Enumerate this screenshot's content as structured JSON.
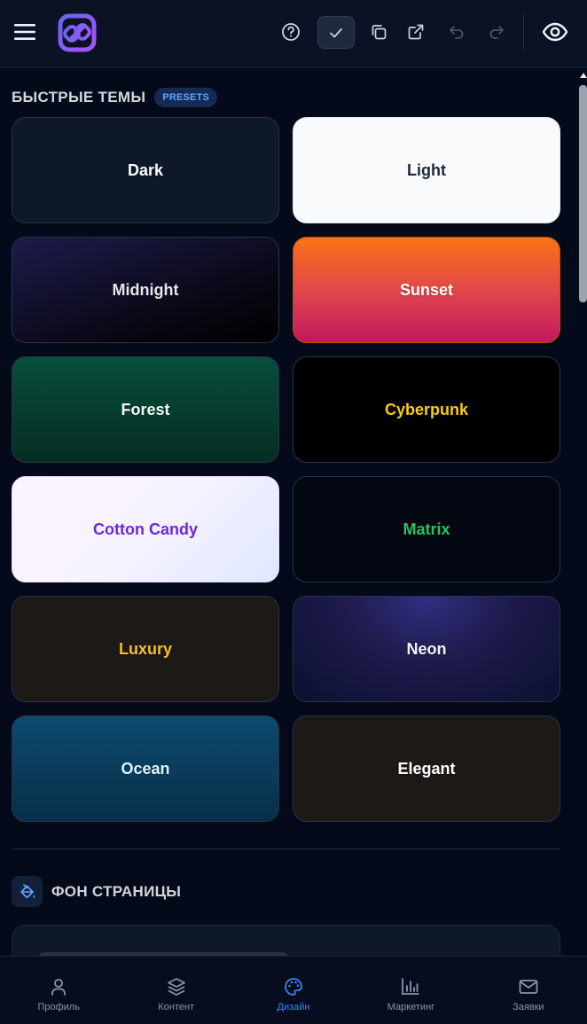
{
  "topbar": {
    "icons": [
      "menu-icon",
      "logo-icon",
      "help-icon",
      "check-icon",
      "copy-icon",
      "external-link-icon",
      "undo-icon",
      "redo-icon",
      "eye-icon"
    ]
  },
  "presets_section": {
    "title": "БЫСТРЫЕ ТЕМЫ",
    "badge": "PRESETS"
  },
  "themes": [
    {
      "label": "Dark"
    },
    {
      "label": "Light"
    },
    {
      "label": "Midnight"
    },
    {
      "label": "Sunset"
    },
    {
      "label": "Forest"
    },
    {
      "label": "Cyberpunk"
    },
    {
      "label": "Cotton Candy"
    },
    {
      "label": "Matrix"
    },
    {
      "label": "Luxury"
    },
    {
      "label": "Neon"
    },
    {
      "label": "Ocean"
    },
    {
      "label": "Elegant"
    }
  ],
  "background_section": {
    "title": "ФОН СТРАНИЦЫ",
    "icon": "paint-bucket-icon"
  },
  "bottom_nav": {
    "items": [
      {
        "label": "Профиль",
        "icon": "user-icon"
      },
      {
        "label": "Контент",
        "icon": "layers-icon"
      },
      {
        "label": "Дизайн",
        "icon": "palette-icon",
        "active": true
      },
      {
        "label": "Маркетинг",
        "icon": "bar-chart-icon"
      },
      {
        "label": "Заявки",
        "icon": "mail-icon"
      }
    ]
  },
  "colors": {
    "accent": "#3b82f6",
    "background": "#050a1a"
  }
}
